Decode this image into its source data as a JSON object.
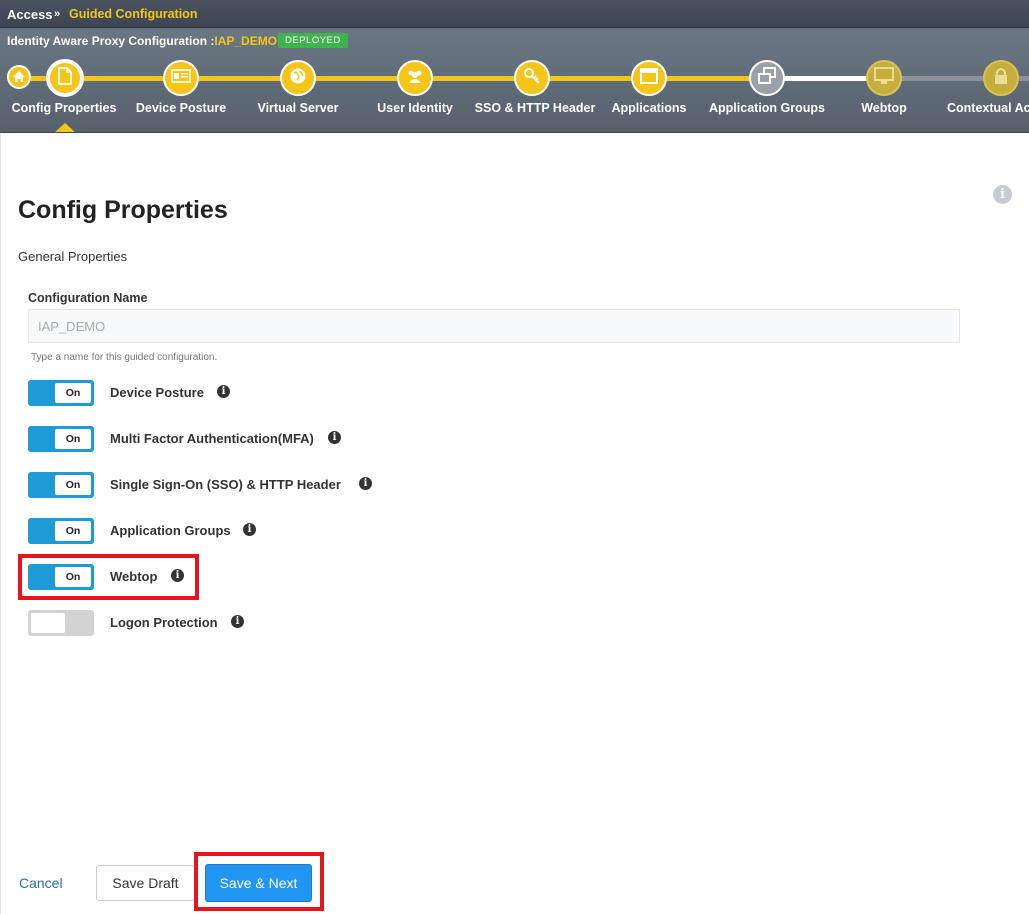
{
  "breadcrumb": {
    "root": "Access",
    "separator": "»",
    "current": "Guided Configuration"
  },
  "wizard": {
    "title_prefix": "Identity Aware Proxy Configuration :",
    "config_name": "IAP_DEMO",
    "status_badge": "DEPLOYED",
    "steps": [
      {
        "label": "Config Properties",
        "icon": "document-icon",
        "state": "active"
      },
      {
        "label": "Device Posture",
        "icon": "id-card-icon",
        "state": "complete"
      },
      {
        "label": "Virtual Server",
        "icon": "globe-icon",
        "state": "complete"
      },
      {
        "label": "User Identity",
        "icon": "users-icon",
        "state": "complete"
      },
      {
        "label": "SSO & HTTP Header",
        "icon": "key-icon",
        "state": "complete"
      },
      {
        "label": "Applications",
        "icon": "window-icon",
        "state": "complete"
      },
      {
        "label": "Application Groups",
        "icon": "groups-icon",
        "state": "complete"
      },
      {
        "label": "Webtop",
        "icon": "monitor-icon",
        "state": "future"
      },
      {
        "label": "Contextual Ac",
        "icon": "lock-icon",
        "state": "future"
      }
    ]
  },
  "main": {
    "title": "Config Properties",
    "section": "General Properties",
    "config_name_label": "Configuration Name",
    "config_name_value": "IAP_DEMO",
    "config_name_help": "Type a name for this guided configuration.",
    "toggles": [
      {
        "label": "Device Posture",
        "state": "On"
      },
      {
        "label": "Multi Factor Authentication(MFA)",
        "state": "On"
      },
      {
        "label": "Single Sign-On (SSO) & HTTP Header",
        "state": "On"
      },
      {
        "label": "Application Groups",
        "state": "On"
      },
      {
        "label": "Webtop",
        "state": "On"
      },
      {
        "label": "Logon Protection",
        "state": ""
      }
    ]
  },
  "footer": {
    "cancel": "Cancel",
    "save_draft": "Save Draft",
    "save_next": "Save & Next"
  },
  "colors": {
    "accent": "#f5c518",
    "primary": "#2196f3",
    "toggle_on": "#1e9ad6",
    "highlight": "#e8141b"
  }
}
